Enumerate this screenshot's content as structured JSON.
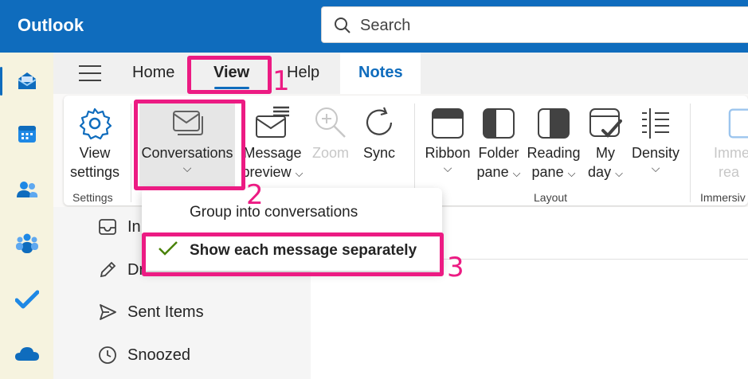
{
  "app": {
    "title": "Outlook"
  },
  "search": {
    "placeholder": "Search"
  },
  "rail": {
    "items": [
      {
        "icon": "mail-icon",
        "active": true
      },
      {
        "icon": "calendar-icon"
      },
      {
        "icon": "people-icon"
      },
      {
        "icon": "teams-icon"
      },
      {
        "icon": "todo-icon"
      },
      {
        "icon": "onedrive-icon"
      }
    ]
  },
  "menubar": {
    "tabs": [
      {
        "label": "Home"
      },
      {
        "label": "View"
      },
      {
        "label": "Help"
      },
      {
        "label": "Notes"
      }
    ]
  },
  "ribbon": {
    "buttons": {
      "view_settings": {
        "line1": "View",
        "line2": "settings",
        "icon": "gear-icon"
      },
      "conversations": {
        "line1": "Conversations",
        "icon": "conversations-icon"
      },
      "message_preview": {
        "line1": "Message",
        "line2": "preview",
        "icon": "message-preview-icon"
      },
      "zoom": {
        "line1": "Zoom",
        "icon": "zoom-icon"
      },
      "sync": {
        "line1": "Sync",
        "icon": "sync-icon"
      },
      "ribbon": {
        "line1": "Ribbon",
        "icon": "ribbon-layout-icon"
      },
      "folder_pane": {
        "line1": "Folder",
        "line2": "pane",
        "icon": "folder-pane-icon"
      },
      "reading_pane": {
        "line1": "Reading",
        "line2": "pane",
        "icon": "reading-pane-icon"
      },
      "my_day": {
        "line1": "My",
        "line2": "day",
        "icon": "my-day-icon"
      },
      "density": {
        "line1": "Density",
        "icon": "density-icon"
      },
      "immersive": {
        "line1": "Imme",
        "line2": "rea",
        "icon": "immersive-reader-icon"
      }
    },
    "groups": {
      "settings": "Settings",
      "layout": "Layout",
      "immersive": "Immersiv"
    }
  },
  "dropdown": {
    "items": [
      {
        "label": "Group into conversations",
        "selected": false
      },
      {
        "label": "Show each message separately",
        "selected": true
      }
    ]
  },
  "folders": [
    {
      "label": "In",
      "icon": "inbox-icon"
    },
    {
      "label": "Dr",
      "icon": "drafts-icon"
    },
    {
      "label": "Sent Items",
      "icon": "sent-icon"
    },
    {
      "label": "Snoozed",
      "icon": "snoozed-icon"
    }
  ],
  "callouts": [
    "1",
    "2",
    "3"
  ],
  "colors": {
    "brand": "#0f6cbd",
    "callout": "#ec1b83",
    "check": "#498205"
  }
}
